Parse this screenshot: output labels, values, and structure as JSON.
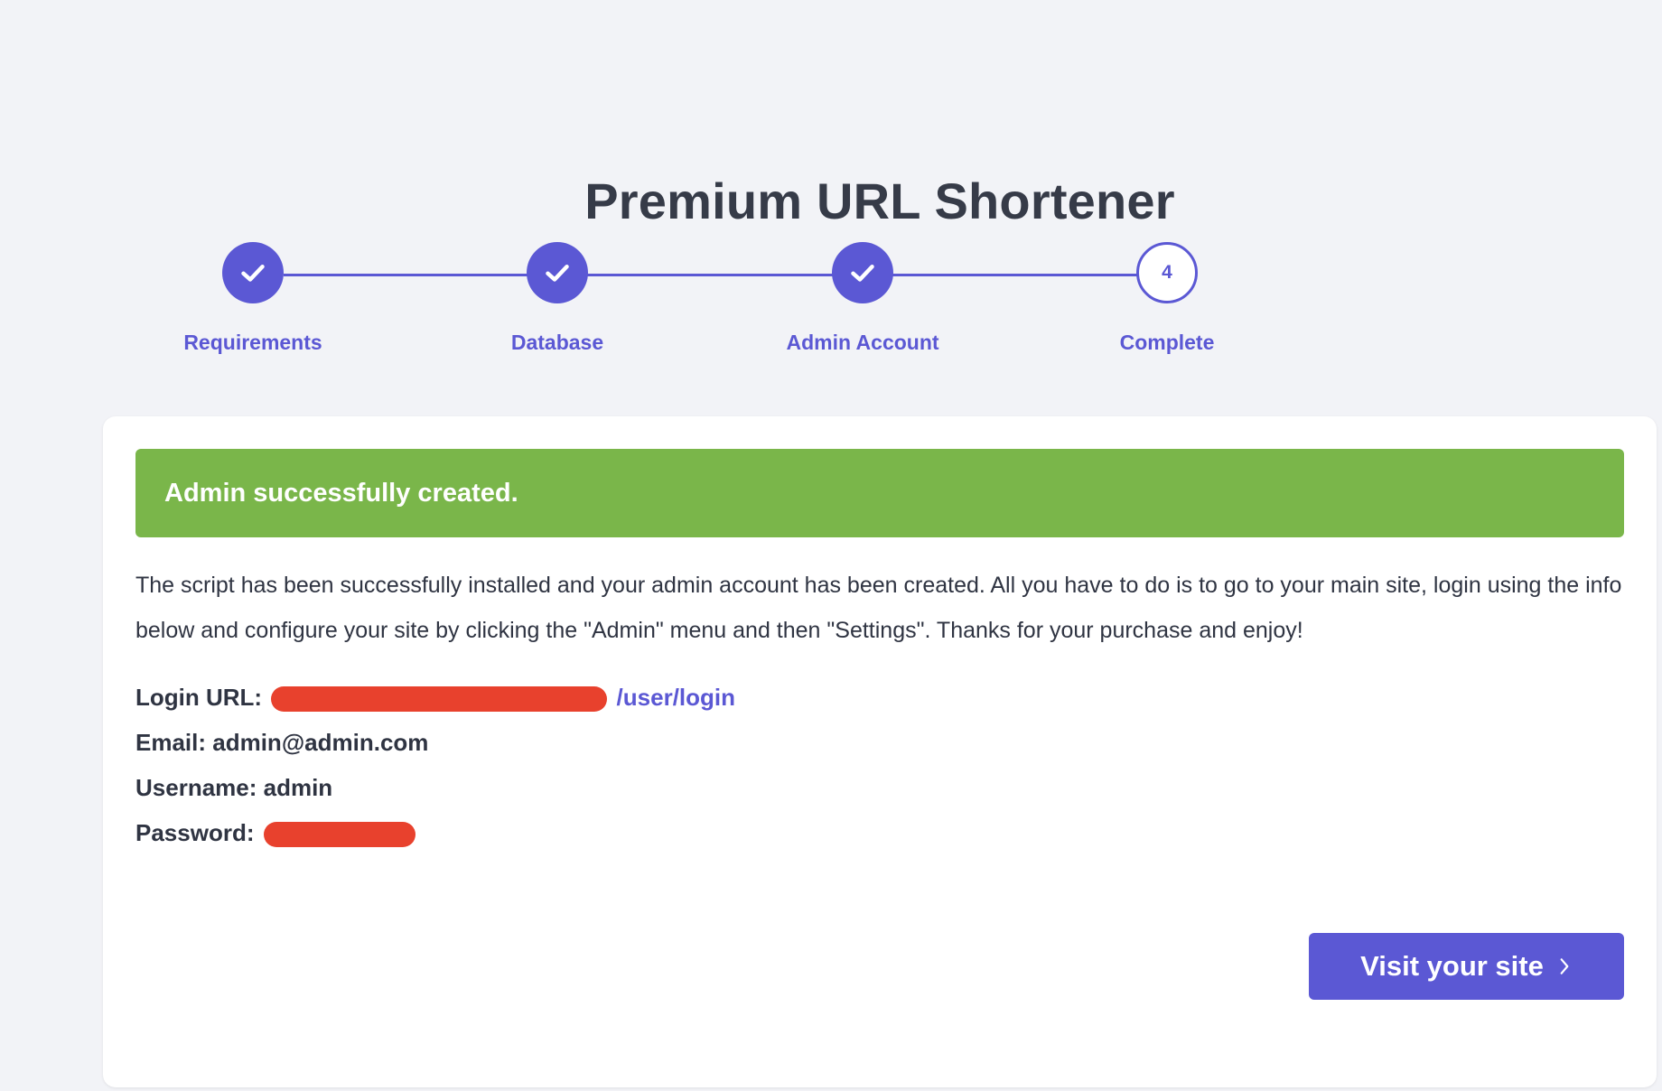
{
  "page": {
    "title": "Premium URL Shortener"
  },
  "stepper": {
    "steps": [
      {
        "label": "Requirements",
        "status": "done",
        "icon": "check-icon"
      },
      {
        "label": "Database",
        "status": "done",
        "icon": "check-icon"
      },
      {
        "label": "Admin Account",
        "status": "done",
        "icon": "check-icon"
      },
      {
        "label": "Complete",
        "status": "current",
        "number": "4"
      }
    ]
  },
  "alert": {
    "message": "Admin successfully created."
  },
  "content": {
    "intro": "The script has been successfully installed and your admin account has been created. All you have to do is to go to your main site, login using the info below and configure your site by clicking the \"Admin\" menu and then \"Settings\". Thanks for your purchase and enjoy!",
    "login_url_label": "Login URL:",
    "login_url_visible": "/user/login",
    "email_text": "Email: admin@admin.com",
    "username_text": "Username: admin",
    "password_label": "Password:"
  },
  "actions": {
    "visit_label": "Visit your site",
    "visit_icon": "chevron-right-icon"
  },
  "colors": {
    "accent": "#5b58d4",
    "success": "#7ab64a",
    "background": "#f2f3f7",
    "redaction": "#e8412d"
  }
}
